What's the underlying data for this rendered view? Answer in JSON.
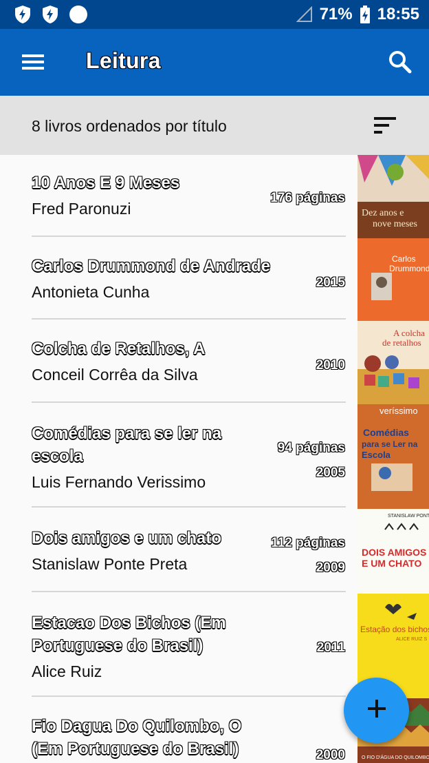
{
  "status_bar": {
    "battery": "71%",
    "time": "18:55",
    "icons": [
      "shield-bolt-icon",
      "shield-bolt-icon",
      "circle-icon",
      "signal-icon",
      "battery-charging-icon"
    ]
  },
  "app_bar": {
    "title": "Leitura",
    "menu_icon": "menu-icon",
    "search_icon": "search-icon",
    "background": "#0763bd",
    "status_background": "#01478f"
  },
  "subheader": {
    "text": "8 livros ordenados por título",
    "sort_icon": "sort-icon"
  },
  "books": [
    {
      "title": "10 Anos E 9 Meses",
      "author": "Fred Paronuzi",
      "pages": "176 páginas",
      "year": "",
      "cover_text": "Dez anos e nove meses"
    },
    {
      "title": "Carlos Drummond de Andrade",
      "author": "Antonieta Cunha",
      "pages": "",
      "year": "2015",
      "cover_text": "Carlos Drummond de Andrade"
    },
    {
      "title": "Colcha de Retalhos, A",
      "author": "Conceil Corrêa da Silva",
      "pages": "",
      "year": "2010",
      "cover_text": "A colcha de retalhos"
    },
    {
      "title": "Comédias para se ler na escola",
      "author": "Luis Fernando Verissimo",
      "pages": "94 páginas",
      "year": "2005",
      "cover_text": "Comédias para se Ler na Escola"
    },
    {
      "title": "Dois amigos e um chato",
      "author": "Stanislaw Ponte Preta",
      "pages": "112 páginas",
      "year": "2009",
      "cover_text": "DOIS AMIGOS E UM CHATO"
    },
    {
      "title": "Estacao Dos Bichos (Em Portuguese do Brasil)",
      "author": "Alice Ruiz",
      "pages": "",
      "year": "2011",
      "cover_text": "Estação dos bichos"
    },
    {
      "title": "Fio Dagua Do Quilombo, O (Em Portuguese do Brasil)",
      "author": "",
      "pages": "",
      "year": "2000",
      "cover_text": "O FIO D'ÁGUA DO QUILOMBO"
    }
  ],
  "fab": {
    "label": "+",
    "icon": "add-icon",
    "color": "#2196f3"
  }
}
